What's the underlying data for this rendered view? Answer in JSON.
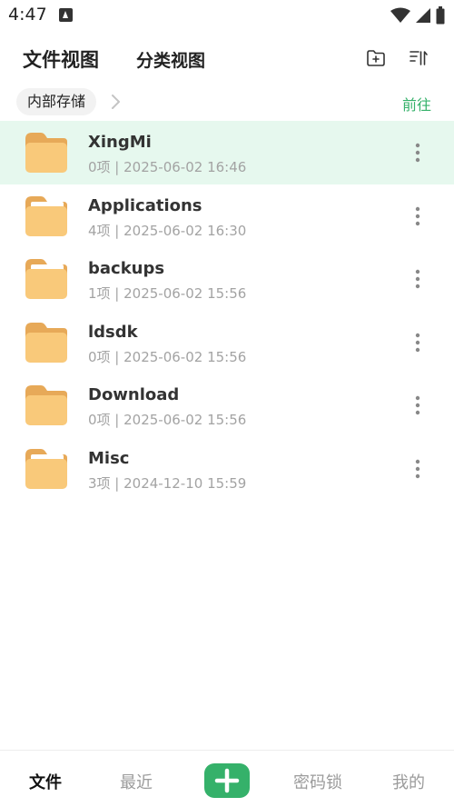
{
  "status_bar": {
    "time": "4:47"
  },
  "header": {
    "tab_file_view": "文件视图",
    "tab_category_view": "分类视图"
  },
  "breadcrumb": {
    "location": "内部存储",
    "goto": "前往"
  },
  "files": [
    {
      "name": "XingMi",
      "meta": "0项 | 2025-06-02 16:46",
      "selected": true
    },
    {
      "name": "Applications",
      "meta": "4项 | 2025-06-02 16:30"
    },
    {
      "name": "backups",
      "meta": "1项 | 2025-06-02 15:56"
    },
    {
      "name": "ldsdk",
      "meta": "0项 | 2025-06-02 15:56"
    },
    {
      "name": "Download",
      "meta": "0项 | 2025-06-02 15:56"
    },
    {
      "name": "Misc",
      "meta": "3项 | 2024-12-10 15:59"
    }
  ],
  "bottom_nav": {
    "files": "文件",
    "recent": "最近",
    "password_lock": "密码锁",
    "mine": "我的"
  },
  "colors": {
    "accent": "#35b16a",
    "folder": "#f9c97a",
    "folder_tab": "#e7a958",
    "selected_row": "#e6f8ee"
  }
}
